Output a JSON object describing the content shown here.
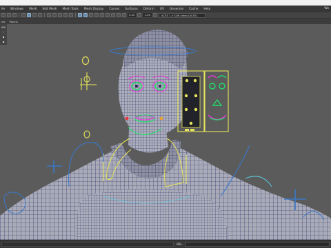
{
  "menubar": {
    "items": [
      "ile",
      "Windows",
      "Mesh",
      "Edit Mesh",
      "Mesh Tools",
      "Mesh Display",
      "Curves",
      "Surfaces",
      "Deform",
      "UV",
      "Generate",
      "Cache",
      "Help"
    ],
    "right_mark": "Wo"
  },
  "statusline": {
    "field_a": "0.00",
    "field_b": "1.00",
    "color_space": "ACES 1.0 SDR-video (ACES)"
  },
  "panelmenu": {
    "items": [
      "ew",
      "Panels"
    ]
  },
  "cmdline": {
    "label": "MEL"
  },
  "colors": {
    "viewport_bg": "#5b5b5b",
    "wire": "#1c1f5c",
    "controls_yellow": "#e8e65a",
    "controls_blue": "#3a78c8",
    "controls_green": "#1fe06a",
    "controls_magenta": "#e83ad8",
    "controls_cyan": "#5ad2e8"
  }
}
